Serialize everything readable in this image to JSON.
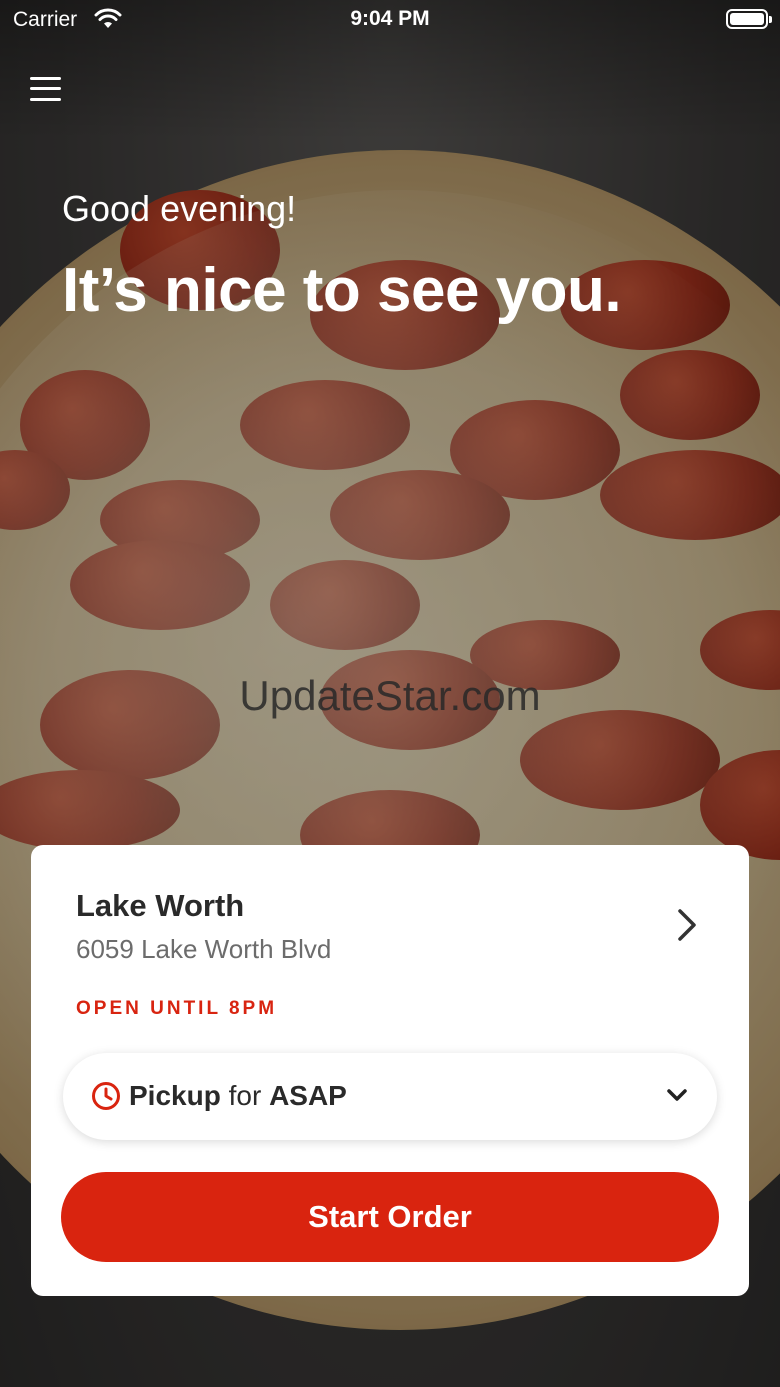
{
  "status_bar": {
    "carrier": "Carrier",
    "time": "9:04 PM"
  },
  "header": {
    "menu_icon": "hamburger-menu-icon"
  },
  "hero": {
    "greeting": "Good evening!",
    "headline": "It’s nice to see you."
  },
  "watermark": "UpdateStar.com",
  "store_card": {
    "name": "Lake Worth",
    "address": "6059 Lake Worth Blvd",
    "hours_status": "OPEN UNTIL 8PM",
    "order_type": {
      "mode": "Pickup",
      "connector": "for",
      "when": "ASAP"
    },
    "start_button": "Start Order"
  },
  "colors": {
    "accent": "#d9240f",
    "status_red": "#d82410"
  }
}
